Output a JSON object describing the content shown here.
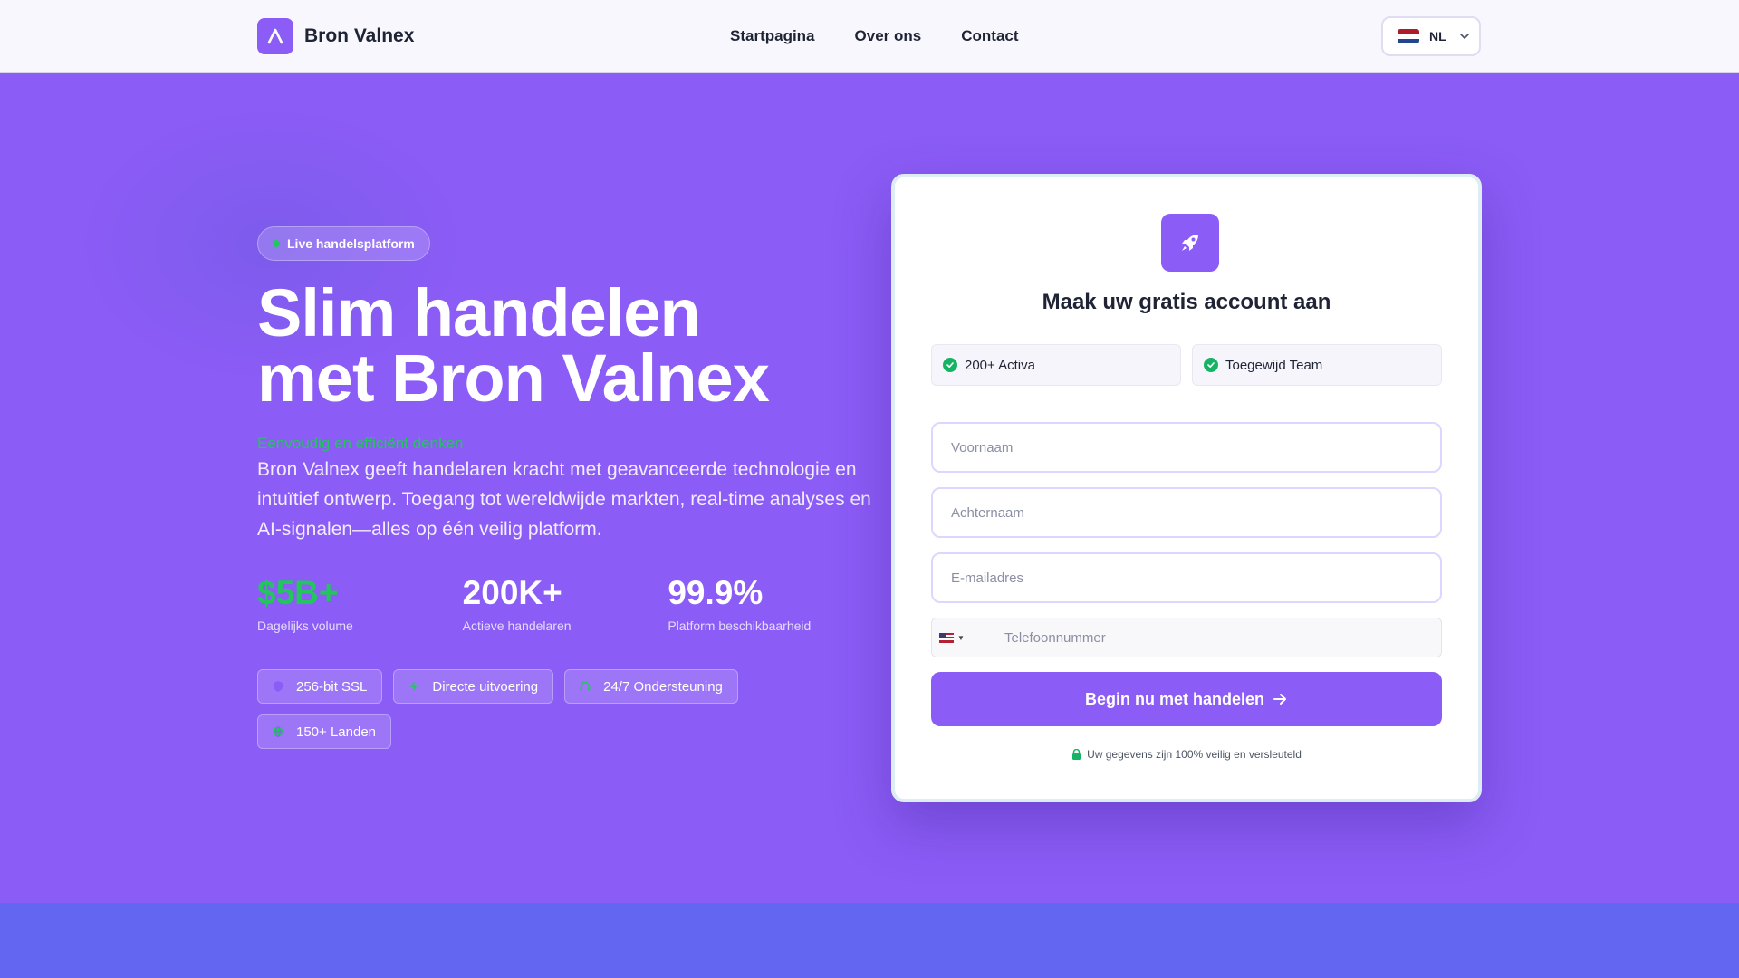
{
  "brand": {
    "name": "Bron Valnex"
  },
  "nav": {
    "items": [
      "Startpagina",
      "Over ons",
      "Contact"
    ]
  },
  "language": {
    "code": "NL"
  },
  "hero": {
    "badge": "Live handelsplatform",
    "headline_line1": "Slim handelen",
    "headline_line2": "met Bron Valnex",
    "tagline": "Eenvoudig en efficiënt denken",
    "lead": "Bron Valnex geeft handelaren kracht met geavanceerde technologie en intuïtief ontwerp. Toegang tot wereldwijde markten, real-time analyses en AI-signalen—alles op één veilig platform.",
    "stats": [
      {
        "value": "$5B+",
        "label": "Dagelijks volume"
      },
      {
        "value": "200K+",
        "label": "Actieve handelaren"
      },
      {
        "value": "99.9%",
        "label": "Platform beschikbaarheid"
      }
    ],
    "features": [
      "256-bit SSL",
      "Directe uitvoering",
      "24/7 Ondersteuning",
      "150+ Landen"
    ]
  },
  "form": {
    "title": "Maak uw gratis account aan",
    "chips": [
      "200+ Activa",
      "Toegewijd Team"
    ],
    "first_name_placeholder": "Voornaam",
    "last_name_placeholder": "Achternaam",
    "email_placeholder": "E-mailadres",
    "phone_placeholder": "Telefoonnummer",
    "submit_label": "Begin nu met handelen",
    "security_note": "Uw gegevens zijn 100% veilig en versleuteld"
  },
  "colors": {
    "brand": "#8b5cf6",
    "accent_green": "#22c55e",
    "band": "#6366f1"
  }
}
